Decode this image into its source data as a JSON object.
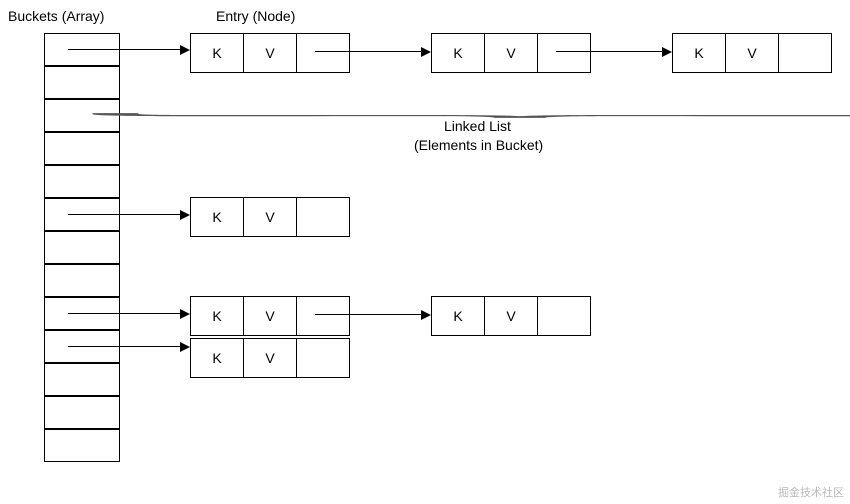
{
  "labels": {
    "buckets": "Buckets (Array)",
    "entry": "Entry (Node)",
    "linked1": "Linked List",
    "linked2": "(Elements in Bucket)"
  },
  "keys": {
    "k": "K",
    "v": "V"
  },
  "watermark": "掘金技术社区"
}
